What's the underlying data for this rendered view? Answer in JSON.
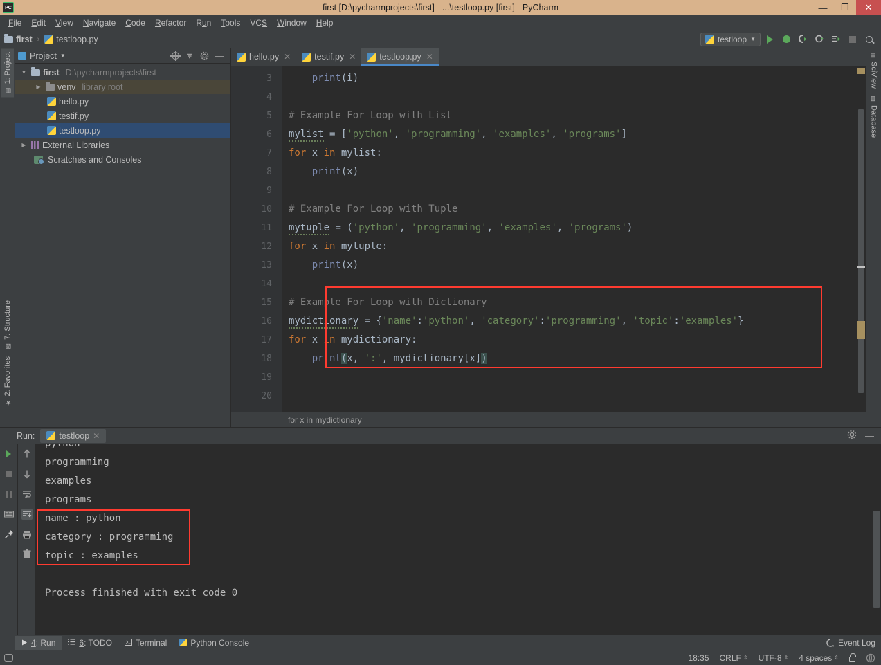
{
  "window": {
    "title": "first [D:\\pycharmprojects\\first] - ...\\testloop.py [first] - PyCharm",
    "logo": "PC",
    "minimize": "—",
    "maximize": "❐",
    "close": "✕"
  },
  "menubar": [
    {
      "label": "File"
    },
    {
      "label": "Edit"
    },
    {
      "label": "View"
    },
    {
      "label": "Navigate"
    },
    {
      "label": "Code"
    },
    {
      "label": "Refactor"
    },
    {
      "label": "Run"
    },
    {
      "label": "Tools"
    },
    {
      "label": "VCS"
    },
    {
      "label": "Window"
    },
    {
      "label": "Help"
    }
  ],
  "navbar": {
    "crumbs": [
      "first",
      "testloop.py"
    ],
    "separator": "›",
    "run_config": "testloop",
    "dropdown_arrow": "▼",
    "buttons": [
      "run-button",
      "debug-button",
      "run-coverage-button",
      "profile-button",
      "run-with-console-button",
      "stop-button",
      "search-everywhere-button"
    ]
  },
  "left_strip": {
    "top": [
      {
        "label": "1: Project",
        "active": true
      }
    ],
    "bottom": [
      {
        "label": "7: Structure"
      },
      {
        "label": "2: Favorites"
      }
    ]
  },
  "right_strip": [
    {
      "label": "SciView"
    },
    {
      "label": "Database"
    }
  ],
  "project_panel": {
    "header_label": "Project",
    "header_arrow": "▼",
    "tree": [
      {
        "indent": 0,
        "arrow": "▼",
        "icon": "folder",
        "label": "first",
        "bold": true,
        "sub": "D:\\pycharmprojects\\first",
        "state": "normal"
      },
      {
        "indent": 1,
        "arrow": "▶",
        "icon": "venv",
        "label": "venv",
        "bold": false,
        "sub": "library root",
        "state": "highlight"
      },
      {
        "indent": 2,
        "arrow": "",
        "icon": "python",
        "label": "hello.py",
        "bold": false,
        "sub": "",
        "state": "normal"
      },
      {
        "indent": 2,
        "arrow": "",
        "icon": "python",
        "label": "testif.py",
        "bold": false,
        "sub": "",
        "state": "normal"
      },
      {
        "indent": 2,
        "arrow": "",
        "icon": "python",
        "label": "testloop.py",
        "bold": false,
        "sub": "",
        "state": "selected"
      },
      {
        "indent": 0,
        "arrow": "▶",
        "icon": "library",
        "label": "External Libraries",
        "bold": false,
        "sub": "",
        "state": "normal"
      },
      {
        "indent": 1,
        "arrow": "",
        "icon": "scratch",
        "label": "Scratches and Consoles",
        "bold": false,
        "sub": "",
        "state": "normal"
      }
    ]
  },
  "editor": {
    "tabs": [
      {
        "label": "hello.py",
        "active": false,
        "close": "✕"
      },
      {
        "label": "testif.py",
        "active": false,
        "close": "✕"
      },
      {
        "label": "testloop.py",
        "active": true,
        "close": "✕"
      }
    ],
    "line_numbers": [
      "3",
      "4",
      "5",
      "6",
      "7",
      "8",
      "9",
      "10",
      "11",
      "12",
      "13",
      "14",
      "15",
      "16",
      "17",
      "18",
      "19",
      "20"
    ],
    "breadcrumb": "for x in mydictionary",
    "code_lines": [
      {
        "n": "3",
        "text": "    print(i)"
      },
      {
        "n": "4",
        "text": ""
      },
      {
        "n": "5",
        "text": "# Example For Loop with List"
      },
      {
        "n": "6",
        "text": "mylist = ['python', 'programming', 'examples', 'programs']"
      },
      {
        "n": "7",
        "text": "for x in mylist:"
      },
      {
        "n": "8",
        "text": "    print(x)"
      },
      {
        "n": "9",
        "text": ""
      },
      {
        "n": "10",
        "text": "# Example For Loop with Tuple"
      },
      {
        "n": "11",
        "text": "mytuple = ('python', 'programming', 'examples', 'programs')"
      },
      {
        "n": "12",
        "text": "for x in mytuple:"
      },
      {
        "n": "13",
        "text": "    print(x)"
      },
      {
        "n": "14",
        "text": ""
      },
      {
        "n": "15",
        "text": "# Example For Loop with Dictionary"
      },
      {
        "n": "16",
        "text": "mydictionary = {'name':'python', 'category':'programming', 'topic':'examples'}"
      },
      {
        "n": "17",
        "text": "for x in mydictionary:"
      },
      {
        "n": "18",
        "text": "    print(x, ':', mydictionary[x])"
      },
      {
        "n": "19",
        "text": ""
      },
      {
        "n": "20",
        "text": ""
      }
    ]
  },
  "run_panel": {
    "label": "Run:",
    "tab_label": "testloop",
    "tab_close": "✕",
    "settings_icon": "⚙",
    "minimize_icon": "—",
    "output_lines": [
      "python",
      "programming",
      "examples",
      "programs",
      "name : python",
      "category : programming",
      "topic : examples",
      "",
      "Process finished with exit code 0"
    ]
  },
  "bottom_tabs": [
    {
      "num": "4",
      "label": ": Run",
      "active": true,
      "icon": "play-icon"
    },
    {
      "num": "6",
      "label": ": TODO",
      "active": false,
      "icon": "list-icon"
    },
    {
      "num": "",
      "label": "Terminal",
      "active": false,
      "icon": "terminal-icon"
    },
    {
      "num": "",
      "label": "Python Console",
      "active": false,
      "icon": "python-icon"
    }
  ],
  "event_log": "Event Log",
  "statusbar": {
    "time": "18:35",
    "line_sep": "CRLF",
    "encoding": "UTF-8",
    "indent": "4 spaces",
    "arrow": "⇕"
  },
  "colors": {
    "titlebar_bg": "#D9B38C",
    "close_btn": "#C75050",
    "ide_bg": "#3C3F41",
    "editor_bg": "#2B2B2B",
    "gutter_bg": "#313335",
    "selection": "#2F4C72",
    "highlight_box": "#FF3B30",
    "keyword": "#CC7832",
    "string": "#6A8759",
    "comment": "#808080",
    "function": "#7D8BB0",
    "accent_tab": "#4A88C7"
  }
}
